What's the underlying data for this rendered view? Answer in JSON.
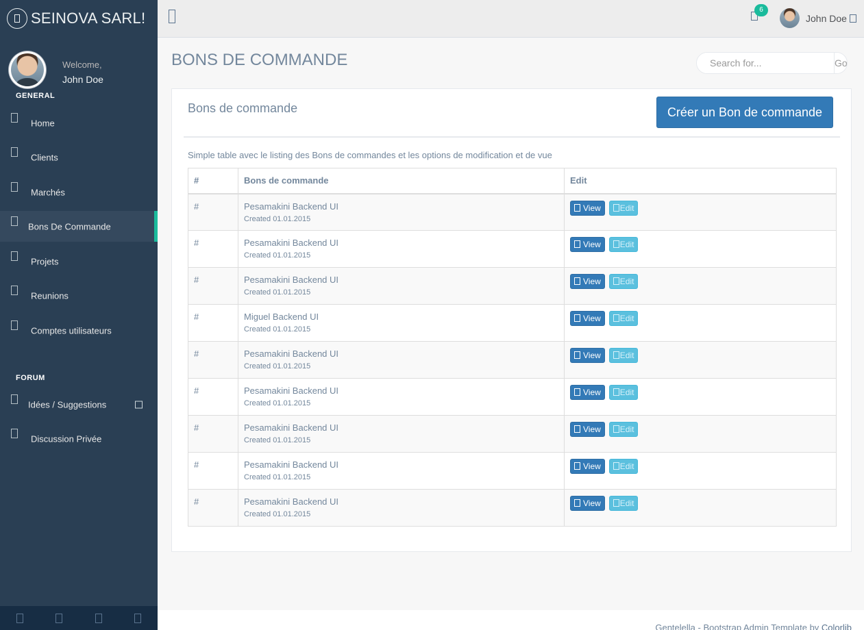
{
  "sidebar": {
    "brand": "SEINOVA SARL!",
    "welcome": "Welcome,",
    "user_name": "John Doe",
    "general_title": "GENERAL",
    "general_items": [
      {
        "label": "Home"
      },
      {
        "label": "Clients"
      },
      {
        "label": "Marchés"
      },
      {
        "label": "Bons De Commande"
      },
      {
        "label": "Projets"
      },
      {
        "label": "Reunions"
      },
      {
        "label": "Comptes utilisateurs"
      }
    ],
    "forum_title": "FORUM",
    "forum_items": [
      {
        "label": "Idées / Suggestions"
      },
      {
        "label": "Discussion Privée"
      }
    ],
    "active_item": "Bons De Commande",
    "accent_color": "#1ABB9C"
  },
  "topnav": {
    "notification_count": "6",
    "user_name": "John Doe"
  },
  "page": {
    "title": "BONS DE COMMANDE",
    "search_placeholder": "Search for...",
    "search_button": "Go!"
  },
  "panel": {
    "title": "Bons de commande",
    "create_button": "Créer un Bon de commande",
    "description": "Simple table avec le listing des Bons de commandes et les options de modification et de vue",
    "columns": [
      "#",
      "Bons de commande",
      "Edit"
    ],
    "view_label": "View",
    "edit_label": "Edit",
    "rows": [
      {
        "num": "#",
        "name": "Pesamakini Backend UI",
        "created": "Created 01.01.2015"
      },
      {
        "num": "#",
        "name": "Pesamakini Backend UI",
        "created": "Created 01.01.2015"
      },
      {
        "num": "#",
        "name": "Pesamakini Backend UI",
        "created": "Created 01.01.2015"
      },
      {
        "num": "#",
        "name": "Miguel Backend UI",
        "created": "Created 01.01.2015"
      },
      {
        "num": "#",
        "name": "Pesamakini Backend UI",
        "created": "Created 01.01.2015"
      },
      {
        "num": "#",
        "name": "Pesamakini Backend UI",
        "created": "Created 01.01.2015"
      },
      {
        "num": "#",
        "name": "Pesamakini Backend UI",
        "created": "Created 01.01.2015"
      },
      {
        "num": "#",
        "name": "Pesamakini Backend UI",
        "created": "Created 01.01.2015"
      },
      {
        "num": "#",
        "name": "Pesamakini Backend UI",
        "created": "Created 01.01.2015"
      }
    ]
  },
  "footer": {
    "text": "Gentelella - Bootstrap Admin Template by ",
    "link": "Colorlib"
  }
}
